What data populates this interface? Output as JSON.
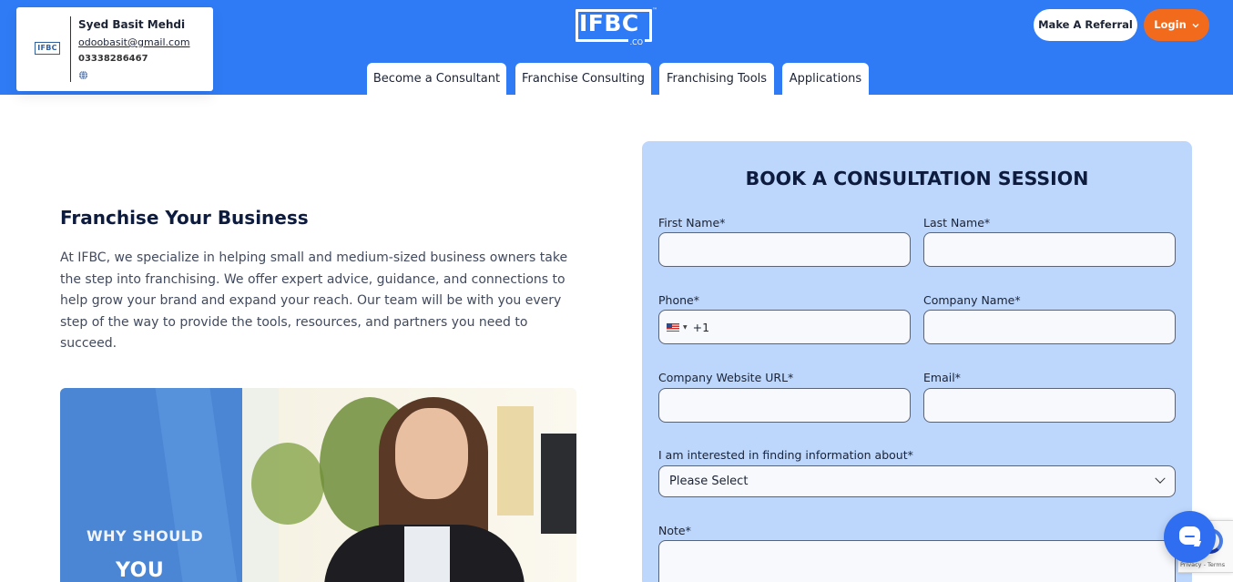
{
  "user_card": {
    "logo_text": "IFBC",
    "name": "Syed Basit Mehdi",
    "email": "odoobasit@gmail.com",
    "phone": "03338286467",
    "website_icon": "globe-icon"
  },
  "header": {
    "logo_main": "IFBC",
    "logo_sub": ".CO",
    "logo_tm": "™",
    "nav_tabs": [
      {
        "label": "Become a Consultant"
      },
      {
        "label": "Franchise Consulting"
      },
      {
        "label": "Franchising Tools"
      },
      {
        "label": "Applications"
      }
    ],
    "referral_label": "Make A Referral",
    "login_label": "Login",
    "login_icon": "chevron-down-icon"
  },
  "hero": {
    "title": "Franchise Your Business",
    "text": "At IFBC, we specialize in helping small and medium-sized business owners take the step into franchising. We offer expert advice, guidance, and connections to help grow your brand and expand your reach. Our team will be with you every step of the way to provide the tools, resources, and partners you need to succeed.",
    "image_caption_line1": "WHY SHOULD",
    "image_caption_line2": "YOU"
  },
  "form": {
    "title": "BOOK A CONSULTATION SESSION",
    "first_name_label": "First Name*",
    "first_name_value": "",
    "last_name_label": "Last Name*",
    "last_name_value": "",
    "phone_label": "Phone*",
    "phone_country_code": "+1",
    "phone_value": "",
    "company_name_label": "Company Name*",
    "company_name_value": "",
    "website_label": "Company Website URL*",
    "website_value": "",
    "email_label": "Email*",
    "email_value": "",
    "interest_label": "I am interested in finding information about*",
    "interest_selected": "Please Select",
    "note_label": "Note*",
    "note_value": ""
  },
  "widgets": {
    "chat_icon": "chat-bubble-icon",
    "recaptcha_text": "Privacy - Terms"
  },
  "colors": {
    "header_blue": "#2f7bf5",
    "login_orange": "#f26b1d",
    "form_bg": "#bcd6fc",
    "heading_navy": "#0d1b3e"
  }
}
